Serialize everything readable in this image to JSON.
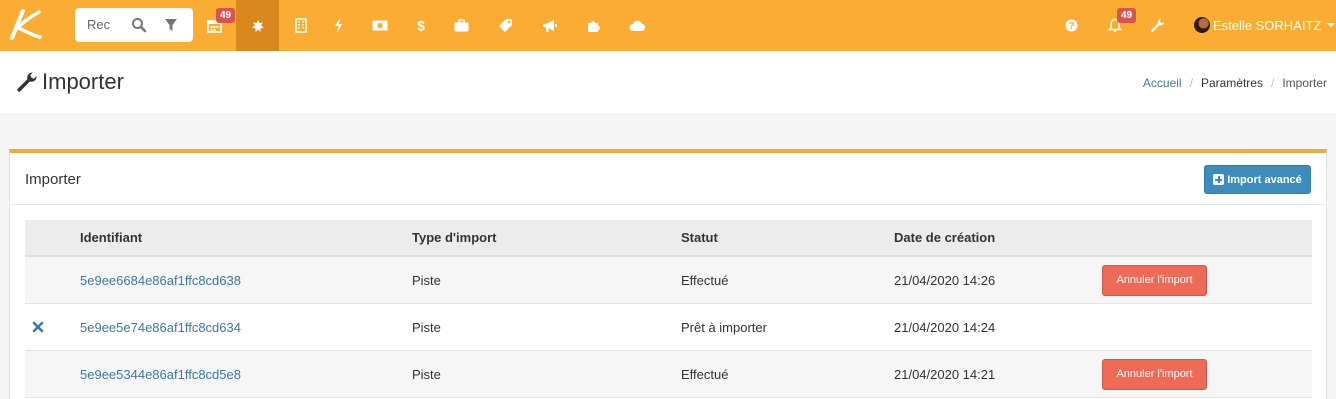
{
  "topbar": {
    "search_placeholder": "Rec",
    "calendar_badge": "49",
    "notifications_badge": "49",
    "user_name": "Estelle SORHAITZ",
    "icons": [
      "calendar-icon",
      "puzzle-icon",
      "building-icon",
      "bolt-icon",
      "money-icon",
      "dollar-icon",
      "briefcase-icon",
      "tag-icon",
      "megaphone-icon",
      "puzzle-piece-icon",
      "cloud-icon",
      "help-icon",
      "bell-icon",
      "wrench-icon"
    ]
  },
  "page": {
    "title": "Importer",
    "breadcrumb": [
      "Accueil",
      "Paramètres",
      "Importer"
    ]
  },
  "panel": {
    "title": "Importer",
    "advanced_button": "Import avancé"
  },
  "table": {
    "headers": [
      "",
      "Identifiant",
      "Type d'import",
      "Statut",
      "Date de création",
      ""
    ],
    "rows": [
      {
        "action_icon": "",
        "id": "5e9ee6684e86af1ffc8cd638",
        "type": "Piste",
        "status": "Effectué",
        "date": "21/04/2020 14:26",
        "cancel": "Annuler l'import"
      },
      {
        "action_icon": "delete-icon",
        "id": "5e9ee5e74e86af1ffc8cd634",
        "type": "Piste",
        "status": "Prêt à importer",
        "date": "21/04/2020 14:24",
        "cancel": ""
      },
      {
        "action_icon": "",
        "id": "5e9ee5344e86af1ffc8cd5e8",
        "type": "Piste",
        "status": "Effectué",
        "date": "21/04/2020 14:21",
        "cancel": "Annuler l'import"
      }
    ]
  },
  "colors": {
    "topbar": "#fbac33",
    "active_tab": "#d9891c",
    "primary": "#3c8dbc",
    "danger": "#ee6a57",
    "link": "#3c78a8"
  }
}
